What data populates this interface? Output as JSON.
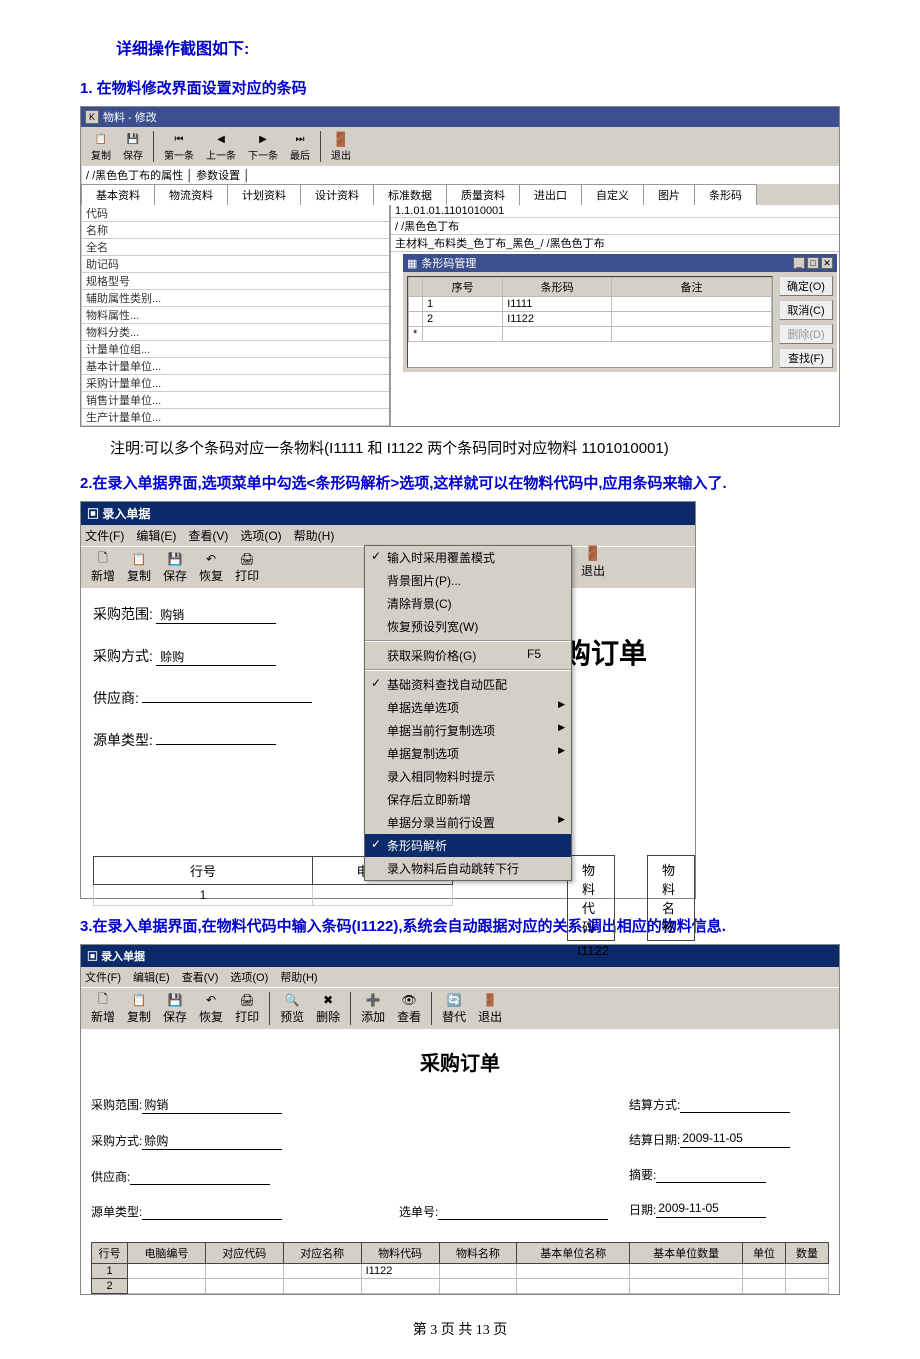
{
  "page": {
    "heading_main": "详细操作截图如下:",
    "section1_title": "1. 在物料修改界面设置对应的条码",
    "section1_note": "注明:可以多个条码对应一条物料(I1111 和 I1122 两个条码同时对应物料 1101010001)",
    "section2_title": "2.在录入单据界面,选项菜单中勾选<条形码解析>选项,这样就可以在物料代码中,应用条码来输入了.",
    "section3_title": "3.在录入单据界面,在物料代码中输入条码(I1122),系统会自动跟据对应的关系,调出相应的物料信息.",
    "footer": "第 3 页 共 13 页"
  },
  "s1": {
    "window_title": "物料 - 修改",
    "toolbar": [
      "复制",
      "保存",
      "第一条",
      "上一条",
      "下一条",
      "最后",
      "退出"
    ],
    "attr_row": "/ /黑色色丁布的属性 │ 参数设置 │",
    "tabs": [
      "基本资料",
      "物流资料",
      "计划资料",
      "设计资料",
      "标准数据",
      "质量资料",
      "进出口",
      "自定义",
      "图片",
      "条形码"
    ],
    "left_fields": [
      "代码",
      "名称",
      "全名",
      "助记码",
      "规格型号",
      "辅助属性类别...",
      "物料属性...",
      "物料分类...",
      "计量单位组...",
      "基本计量单位...",
      "采购计量单位...",
      "销售计量单位...",
      "生产计量单位..."
    ],
    "right_vals": [
      "1.1.01.01.1101010001",
      "/ /黑色色丁布",
      "主材料_布料类_色丁布_黑色_/ /黑色色丁布"
    ],
    "popup_title": "条形码管理",
    "grid_headers": [
      "序号",
      "条形码",
      "备注"
    ],
    "grid_rows": [
      {
        "n": "1",
        "code": "I1111",
        "note": ""
      },
      {
        "n": "2",
        "code": "I1122",
        "note": ""
      }
    ],
    "popup_btns": [
      "确定(O)",
      "取消(C)",
      "删除(D)",
      "查找(F)"
    ]
  },
  "s2": {
    "window_title": "录入单据",
    "menubar": [
      "文件(F)",
      "编辑(E)",
      "查看(V)",
      "选项(O)",
      "帮助(H)"
    ],
    "toolbar": [
      "新增",
      "复制",
      "保存",
      "恢复",
      "打印"
    ],
    "exit_label": "退出",
    "dropdown": [
      {
        "t": "输入时采用覆盖模式",
        "chk": true
      },
      {
        "t": "背景图片(P)..."
      },
      {
        "t": "清除背景(C)"
      },
      {
        "t": "恢复预设列宽(W)"
      },
      {
        "sep": true
      },
      {
        "t": "获取采购价格(G)",
        "sc": "F5"
      },
      {
        "sep": true
      },
      {
        "t": "基础资料查找自动匹配",
        "chk": true
      },
      {
        "t": "单据选单选项",
        "sub": true
      },
      {
        "t": "单据当前行复制选项",
        "sub": true
      },
      {
        "t": "单据复制选项",
        "sub": true
      },
      {
        "t": "录入相同物料时提示"
      },
      {
        "t": "保存后立即新增"
      },
      {
        "t": "单据分录当前行设置",
        "sub": true
      },
      {
        "t": "条形码解析",
        "chk": true,
        "hi": true
      },
      {
        "t": "录入物料后自动跳转下行"
      }
    ],
    "doc_title": "采购订单",
    "form": {
      "range_label": "采购范围:",
      "range_val": "购销",
      "method_label": "采购方式:",
      "method_val": "赊购",
      "supplier_label": "供应商:",
      "srctype_label": "源单类型:"
    },
    "table_headers": [
      "行号",
      "电脑编号"
    ],
    "table_row": {
      "n": "1",
      "code": ""
    },
    "after_cols": [
      "物料代码",
      "物料名称"
    ],
    "after_val": "I1122"
  },
  "s3": {
    "window_title": "录入单据",
    "menubar": [
      "文件(F)",
      "编辑(E)",
      "查看(V)",
      "选项(O)",
      "帮助(H)"
    ],
    "toolbar": [
      "新增",
      "复制",
      "保存",
      "恢复",
      "打印",
      "预览",
      "删除",
      "添加",
      "查看",
      "替代",
      "退出"
    ],
    "doc_title": "采购订单",
    "left_rows": [
      {
        "l": "采购范围:",
        "v": "购销"
      },
      {
        "l": "采购方式:",
        "v": "赊购"
      },
      {
        "l": "供应商:",
        "v": ""
      },
      {
        "l": "源单类型:",
        "v": ""
      }
    ],
    "mid_row": {
      "l": "选单号:",
      "v": ""
    },
    "right_rows": [
      {
        "l": "结算方式:",
        "v": ""
      },
      {
        "l": "结算日期:",
        "v": "2009-11-05"
      },
      {
        "l": "摘要:",
        "v": ""
      },
      {
        "l": "日期:",
        "v": "2009-11-05"
      }
    ],
    "table_headers": [
      "行号",
      "电脑编号",
      "对应代码",
      "对应名称",
      "物料代码",
      "物料名称",
      "基本单位名称",
      "基本单位数量",
      "单位",
      "数量"
    ],
    "rows": [
      {
        "n": "1",
        "mcode": "I1122"
      },
      {
        "n": "2",
        "mcode": ""
      }
    ]
  }
}
